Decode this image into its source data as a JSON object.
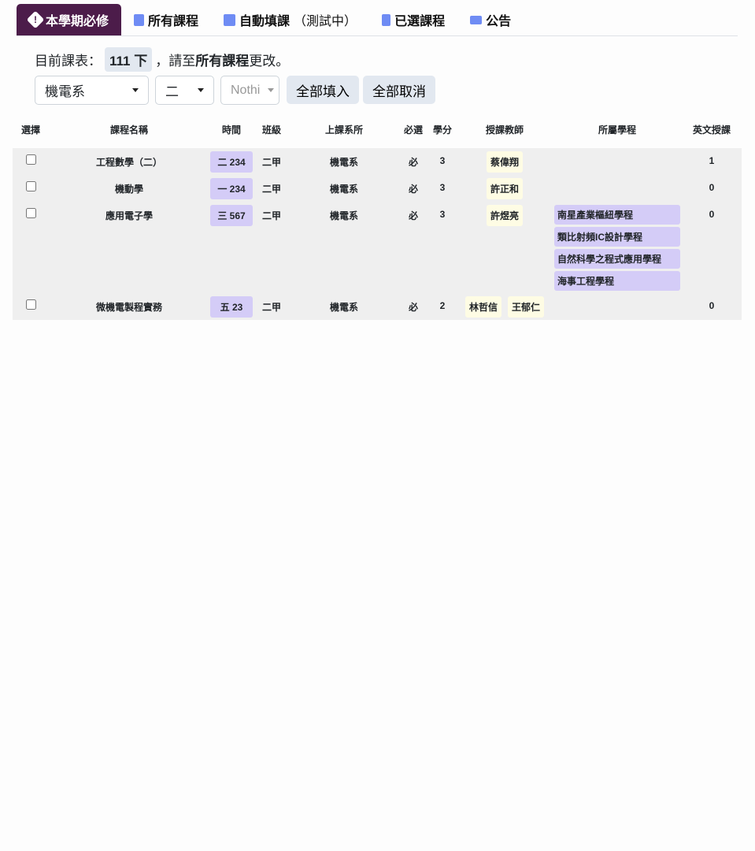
{
  "tabs": [
    {
      "label": "本學期必修",
      "icon": "exclamation-diamond-icon",
      "active": true
    },
    {
      "label": "所有課程",
      "icon": "file-plus-icon"
    },
    {
      "label": "自動填課",
      "suffix": "（測試中）",
      "icon": "grid-icon"
    },
    {
      "label": "已選課程",
      "icon": "bookmark-check-icon"
    },
    {
      "label": "公告",
      "icon": "megaphone-icon"
    }
  ],
  "info": {
    "prefix": "目前課表：",
    "semester": "111 下",
    "middle": "，請至",
    "link": "所有課程",
    "suffix": "更改。"
  },
  "controls": {
    "department": "機電系",
    "grade": "二",
    "class_placeholder": "Nothi",
    "fill_all": "全部填入",
    "cancel_all": "全部取消"
  },
  "table": {
    "headers": [
      "選擇",
      "課程名稱",
      "時間",
      "班級",
      "上課系所",
      "必選",
      "學分",
      "授課教師",
      "所屬學程",
      "英文授課"
    ],
    "rows": [
      {
        "name": "工程數學（二）",
        "time": "二 234",
        "class": "二甲",
        "dept": "機電系",
        "req": "必",
        "credit": "3",
        "teachers": [
          "蔡偉翔"
        ],
        "programs": [],
        "english": "1"
      },
      {
        "name": "機動學",
        "time": "一 234",
        "class": "二甲",
        "dept": "機電系",
        "req": "必",
        "credit": "3",
        "teachers": [
          "許正和"
        ],
        "programs": [],
        "english": "0"
      },
      {
        "name": "應用電子學",
        "time": "三 567",
        "class": "二甲",
        "dept": "機電系",
        "req": "必",
        "credit": "3",
        "teachers": [
          "許煜亮"
        ],
        "programs": [
          "南星產業樞紐學程",
          "類比射頻IC設計學程",
          "自然科學之程式應用學程",
          "海事工程學程"
        ],
        "english": "0"
      },
      {
        "name": "微機電製程實務",
        "time": "五 23",
        "class": "二甲",
        "dept": "機電系",
        "req": "必",
        "credit": "2",
        "teachers": [
          "林哲信",
          "王郁仁"
        ],
        "programs": [],
        "english": "0"
      }
    ]
  }
}
